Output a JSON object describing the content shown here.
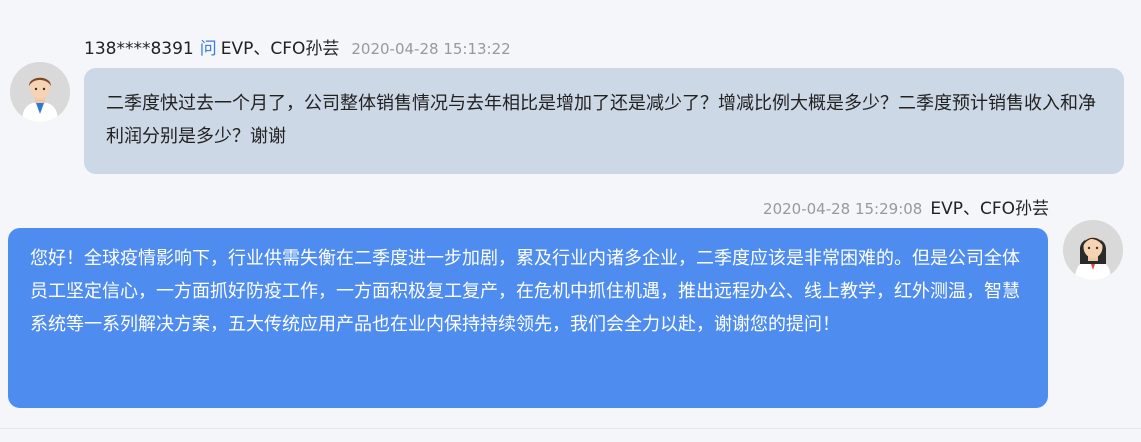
{
  "question": {
    "asker": "138****8391",
    "ask_word": "问",
    "addressee": "EVP、CFO孙芸",
    "time": "2020-04-28 15:13:22",
    "text": "二季度快过去一个月了，公司整体销售情况与去年相比是增加了还是减少了？增减比例大概是多少？二季度预计销售收入和净利润分别是多少？谢谢"
  },
  "answer": {
    "time": "2020-04-28 15:29:08",
    "responder": "EVP、CFO孙芸",
    "text": "您好！全球疫情影响下，行业供需失衡在二季度进一步加剧，累及行业内诸多企业，二季度应该是非常困难的。但是公司全体员工坚定信心，一方面抓好防疫工作，一方面积极复工复产，在危机中抓住机遇，推出远程办公、线上教学，红外测温，智慧系统等一系列解决方案，五大传统应用产品也在业内保持持续领先，我们会全力以赴，谢谢您的提问！"
  },
  "colors": {
    "question_bubble": "#cdd8e6",
    "answer_bubble": "#4e8cf0",
    "ask_word": "#3c7be0",
    "timestamp": "#999999"
  },
  "icons": {
    "asker_avatar": "male-user-avatar-icon",
    "responder_avatar": "female-user-avatar-icon"
  }
}
